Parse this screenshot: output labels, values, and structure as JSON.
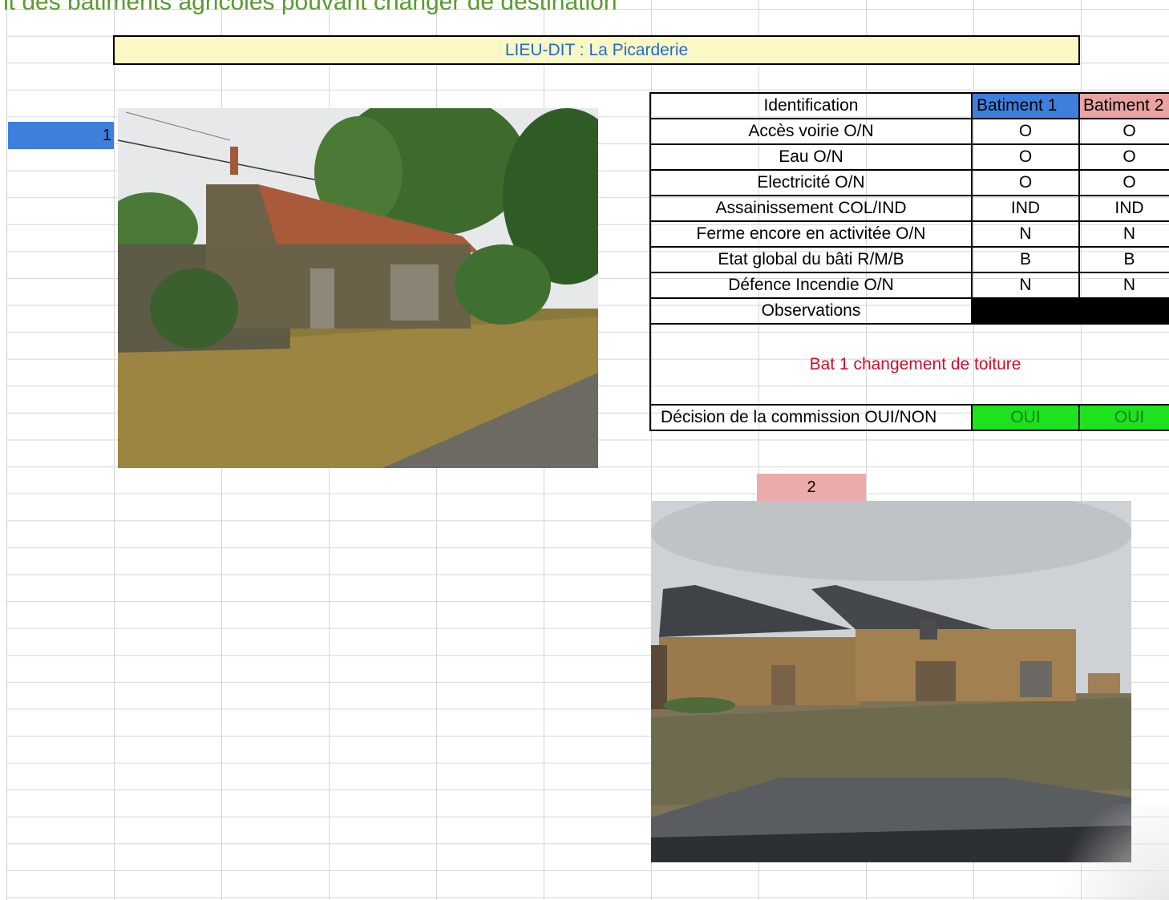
{
  "page_title": "nt des bâtiments agricoles pouvant changer de destination",
  "lieu_dit": "LIEU-DIT : La Picarderie",
  "badges": {
    "building_1": "1",
    "building_2": "2"
  },
  "table": {
    "headers": [
      "Identification",
      "Batiment 1",
      "Batiment 2"
    ],
    "rows": [
      {
        "label": "Accès voirie O/N",
        "b1": "O",
        "b2": "O"
      },
      {
        "label": "Eau O/N",
        "b1": "O",
        "b2": "O"
      },
      {
        "label": "Electricité O/N",
        "b1": "O",
        "b2": "O"
      },
      {
        "label": "Assainissement COL/IND",
        "b1": "IND",
        "b2": "IND"
      },
      {
        "label": "Ferme encore en activitée O/N",
        "b1": "N",
        "b2": "N"
      },
      {
        "label": "Etat global du bâti R/M/B",
        "b1": "B",
        "b2": "B"
      },
      {
        "label": "Défence Incendie O/N",
        "b1": "N",
        "b2": "N"
      }
    ],
    "observations_label": "Observations",
    "observations_text": "Bat 1 changement de toiture",
    "decision_label": "Décision de la commission OUI/NON",
    "decision_b1": "OUI",
    "decision_b2": "OUI"
  },
  "colors": {
    "title_green": "#5a9a2f",
    "lieu_dit_bg": "#fbf8c6",
    "lieu_dit_text": "#1f6bd0",
    "batiment1_blue": "#3f7fdc",
    "batiment2_pink": "#e9a3a3",
    "observation_red": "#c8102e",
    "decision_green": "#1ee21e"
  }
}
